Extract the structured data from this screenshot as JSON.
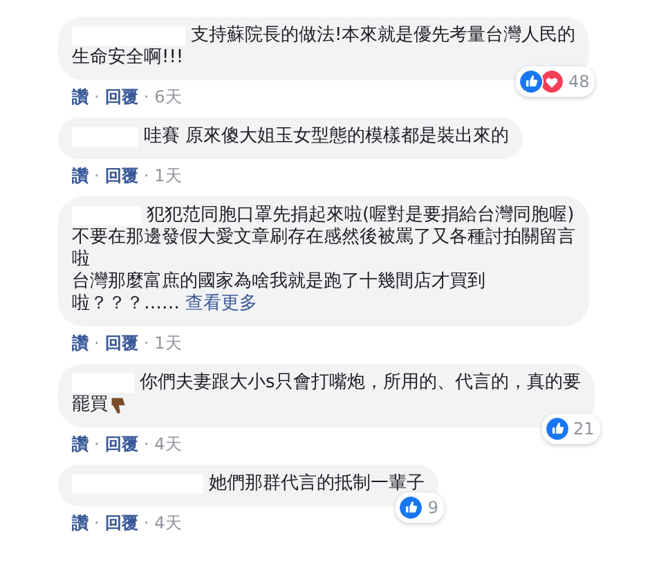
{
  "comments": [
    {
      "name_hidden": true,
      "lines": [
        "支持蘇院長的做法!本來就是優先考量台灣人民的",
        "生命安全啊!!!"
      ],
      "reactions": {
        "kinds": [
          {
            "kind": "like"
          },
          {
            "kind": "love"
          }
        ],
        "count": "48"
      },
      "actions": [
        {
          "kind": "link",
          "text": "讚"
        },
        {
          "kind": "sep",
          "text": "·"
        },
        {
          "kind": "link",
          "text": "回覆"
        },
        {
          "kind": "sep",
          "text": "·"
        },
        {
          "kind": "time",
          "text": "6天"
        }
      ]
    },
    {
      "name_hidden": true,
      "lines": [
        "哇賽 原來傻大姐玉女型態的模樣都是裝出來的"
      ],
      "actions": [
        {
          "kind": "link",
          "text": "讚"
        },
        {
          "kind": "sep",
          "text": "·"
        },
        {
          "kind": "link",
          "text": "回覆"
        },
        {
          "kind": "sep",
          "text": "·"
        },
        {
          "kind": "time",
          "text": "1天"
        }
      ]
    },
    {
      "name_hidden": true,
      "lines": [
        "犯犯范同胞口罩先捐起來啦(喔對是要捐給台灣同胞喔)",
        "不要在那邊發假大愛文章刷存在感然後被罵了又各種討拍關留言",
        "啦",
        "台灣那麼富庶的國家為啥我就是跑了十幾間店才買到",
        "啦？？？……"
      ],
      "see_more": "查看更多",
      "actions": [
        {
          "kind": "link",
          "text": "讚"
        },
        {
          "kind": "sep",
          "text": "·"
        },
        {
          "kind": "link",
          "text": "回覆"
        },
        {
          "kind": "sep",
          "text": "·"
        },
        {
          "kind": "time",
          "text": "1天"
        }
      ]
    },
    {
      "name_hidden": true,
      "lines": [
        "你們夫妻跟大小s只會打嘴炮，所用的、代言的，真的要",
        "罷買"
      ],
      "emoji": {
        "kind": "thumbs-down"
      },
      "reactions": {
        "kinds": [
          {
            "kind": "like"
          }
        ],
        "count": "21"
      },
      "actions": [
        {
          "kind": "link",
          "text": "讚"
        },
        {
          "kind": "sep",
          "text": "·"
        },
        {
          "kind": "link",
          "text": "回覆"
        },
        {
          "kind": "sep",
          "text": "·"
        },
        {
          "kind": "time",
          "text": "4天"
        }
      ]
    },
    {
      "name_hidden": true,
      "lines": [
        "她們那群代言的抵制一輩子"
      ],
      "reactions": {
        "kinds": [
          {
            "kind": "like"
          }
        ],
        "count": "9"
      },
      "actions": [
        {
          "kind": "link",
          "text": "讚"
        },
        {
          "kind": "sep",
          "text": "·"
        },
        {
          "kind": "link",
          "text": "回覆"
        },
        {
          "kind": "sep",
          "text": "·"
        },
        {
          "kind": "time",
          "text": "4天"
        }
      ]
    }
  ]
}
